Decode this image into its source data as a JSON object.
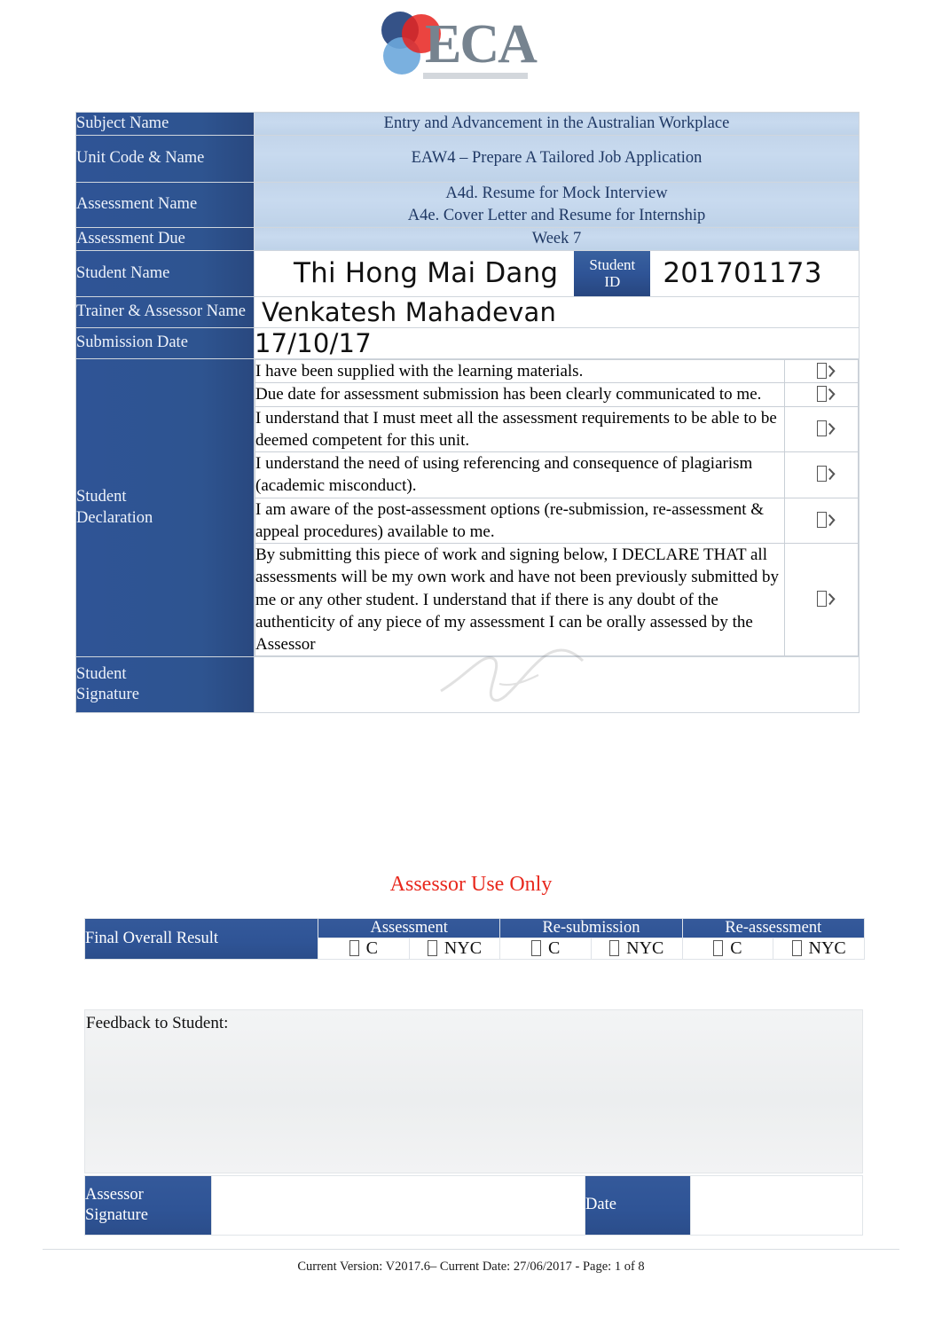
{
  "logo": {
    "text": "ECA",
    "colors": {
      "dark_blue": "#1f3f7a",
      "red": "#e8231e",
      "light_blue": "#6ba7dc",
      "wordmark": "#7b8896"
    }
  },
  "header_table": {
    "rows": [
      {
        "label": "Subject Name",
        "value": "Entry and Advancement in the Australian Workplace"
      },
      {
        "label": "Unit Code & Name",
        "value": "EAW4   – Prepare A Tailored Job Application"
      },
      {
        "label": "Assessment Name",
        "value_line1": "A4d. Resume for Mock Interview",
        "value_line2": "A4e. Cover Letter and Resume for Internship"
      },
      {
        "label": "Assessment Due",
        "value": "Week   7"
      }
    ],
    "student_name": {
      "label": "Student Name",
      "value": "Thi Hong Mai Dang"
    },
    "student_id": {
      "label_line1": "Student",
      "label_line2": "ID",
      "value": "201701173"
    },
    "trainer": {
      "label": "Trainer & Assessor Name",
      "value": "Venkatesh Mahadevan"
    },
    "submission_date": {
      "label": "Submission Date",
      "value": "17/10/17"
    }
  },
  "declaration": {
    "label_line1": "Student",
    "label_line2": "Declaration",
    "items": [
      {
        "text": "I have been supplied with the learning materials.",
        "checkbox": "checked-box-glyph"
      },
      {
        "text": "Due date for assessment submission has been clearly communicated to me.",
        "checkbox": "checked-box-glyph"
      },
      {
        "text": "I understand that I must meet all the assessment requirements to be able to be deemed competent for this unit.",
        "checkbox": "checked-box-glyph"
      },
      {
        "text": "I understand the need of using referencing and consequence of plagiarism (academic misconduct).",
        "checkbox": "checked-box-glyph"
      },
      {
        "text": "I am aware of the post-assessment options (re-submission, re-assessment & appeal procedures) available to me.",
        "checkbox": "checked-box-glyph"
      },
      {
        "text": "By submitting this piece of work and signing below, I DECLARE THAT all assessments will be my own work and have not been previously submitted by me or any other student. I understand that if there is any doubt of the authenticity of any piece of my assessment I can be orally assessed by the Assessor",
        "checkbox": "checked-box-glyph"
      }
    ]
  },
  "student_signature": {
    "label_line1": "Student",
    "label_line2": "Signature",
    "value": ""
  },
  "assessor_section": {
    "title": "Assessor Use Only",
    "title_color": "#e8291e",
    "final_result_label": "Final Overall Result",
    "column_headers": [
      "Assessment",
      "Re-submission",
      "Re-assessment"
    ],
    "options": [
      {
        "label": "C",
        "checkbox": "empty-box-glyph"
      },
      {
        "label": "NYC",
        "checkbox": "empty-box-glyph"
      },
      {
        "label": "C",
        "checkbox": "empty-box-glyph"
      },
      {
        "label": "NYC",
        "checkbox": "empty-box-glyph"
      },
      {
        "label": "C",
        "checkbox": "empty-box-glyph"
      },
      {
        "label": "NYC",
        "checkbox": "empty-box-glyph"
      }
    ],
    "feedback_label": "Feedback to Student:",
    "feedback_value": "",
    "assessor_signature": {
      "label_line1": "Assessor",
      "label_line2": "Signature",
      "value": ""
    },
    "date": {
      "label": "Date",
      "value": ""
    }
  },
  "footer": {
    "text": "Current Version:  V2017.6– Current Date:  27/06/2017 -  Page: 1 of 8"
  },
  "theme": {
    "dark_blue": "#2f5496",
    "light_blue": "#c6d9f1",
    "value_text_blue": "#1f3864",
    "red": "#e8291e"
  }
}
